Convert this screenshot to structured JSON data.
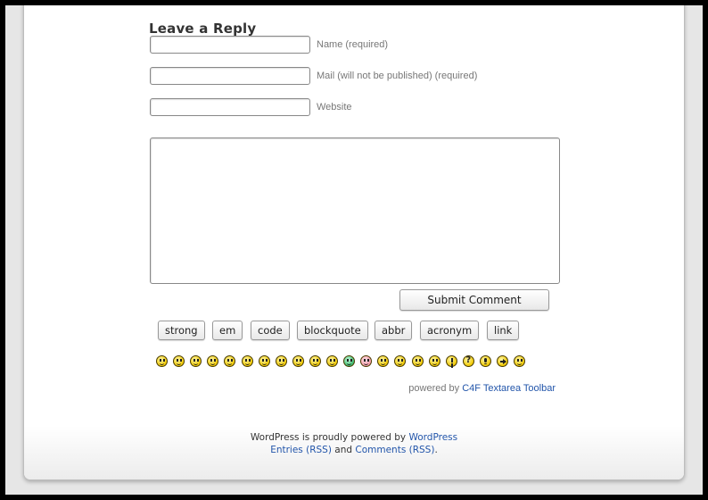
{
  "reply": {
    "heading": "Leave a Reply",
    "name_label": "Name (required)",
    "mail_label": "Mail (will not be published) (required)",
    "website_label": "Website",
    "name_value": "",
    "mail_value": "",
    "website_value": "",
    "comment_value": "",
    "submit_label": "Submit Comment"
  },
  "toolbar": {
    "buttons": [
      "strong",
      "em",
      "code",
      "blockquote",
      "abbr",
      "acronym",
      "link"
    ]
  },
  "smileys": [
    {
      "icon": "smile-icon"
    },
    {
      "icon": "grin-icon"
    },
    {
      "icon": "sad-icon"
    },
    {
      "icon": "surprised-icon"
    },
    {
      "icon": "shocked-icon"
    },
    {
      "icon": "confused-icon"
    },
    {
      "icon": "cool-icon"
    },
    {
      "icon": "laughing-icon"
    },
    {
      "icon": "mad-icon"
    },
    {
      "icon": "razz-icon"
    },
    {
      "icon": "wink-icon"
    },
    {
      "icon": "mrgreen-icon"
    },
    {
      "icon": "embarrassed-icon"
    },
    {
      "icon": "cry-icon"
    },
    {
      "icon": "evil-icon"
    },
    {
      "icon": "twisted-icon"
    },
    {
      "icon": "rolleyes-icon"
    },
    {
      "icon": "exclaim-icon"
    },
    {
      "icon": "question-icon"
    },
    {
      "icon": "idea-icon"
    },
    {
      "icon": "arrow-icon"
    },
    {
      "icon": "neutral-icon"
    }
  ],
  "powered": {
    "prefix": "powered by",
    "link": "C4F Textarea Toolbar"
  },
  "footer": {
    "line1_prefix": "WordPress is proudly powered by",
    "line1_link": "WordPress",
    "entries_link": "Entries (RSS)",
    "and": "and",
    "comments_link": "Comments (RSS)",
    "period": "."
  },
  "colors": {
    "link": "#2255aa",
    "label": "#777777",
    "window_bg": "#e6e6e6"
  }
}
